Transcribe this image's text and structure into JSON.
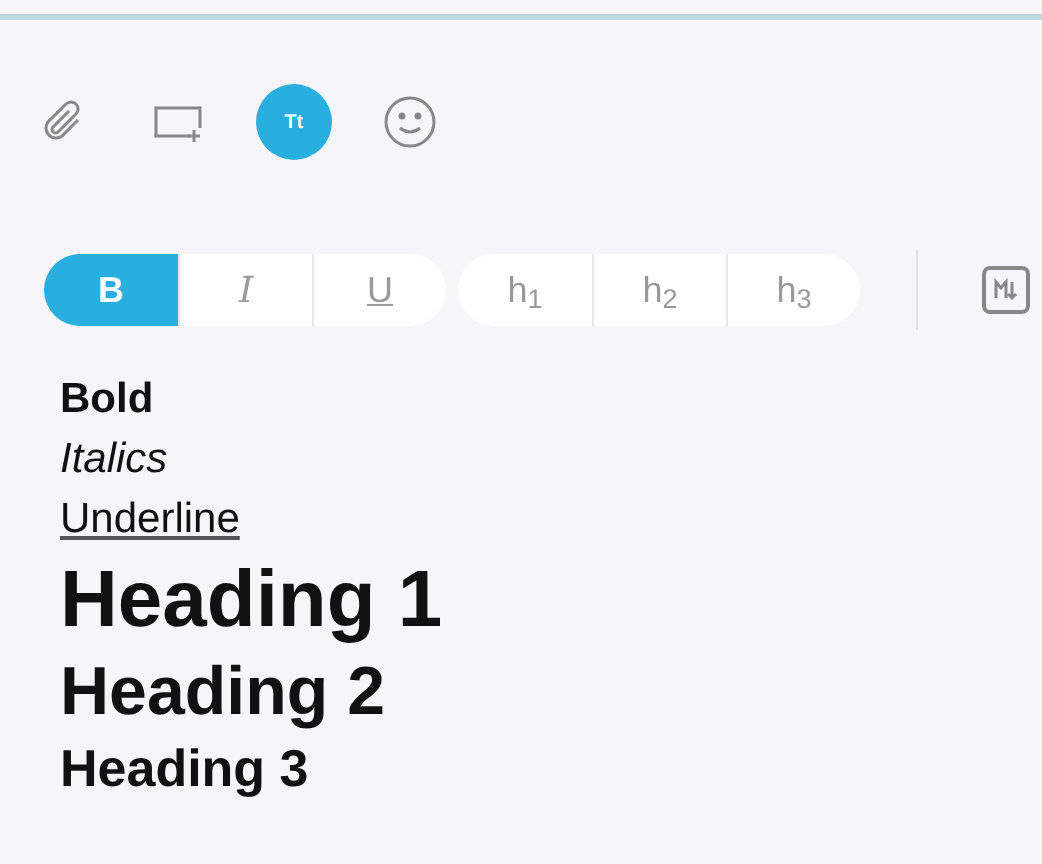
{
  "insert_toolbar": [
    {
      "kind": "attachment",
      "selected": false
    },
    {
      "kind": "image",
      "selected": false
    },
    {
      "kind": "text",
      "selected": true,
      "label": "Tt"
    },
    {
      "kind": "emoji",
      "selected": false
    }
  ],
  "format_groups": [
    {
      "buttons": [
        {
          "kind": "bold",
          "label": "B",
          "selected": true
        },
        {
          "kind": "italic",
          "label": "I",
          "selected": false
        },
        {
          "kind": "underline",
          "label": "U",
          "selected": false
        }
      ]
    },
    {
      "buttons": [
        {
          "kind": "heading",
          "label": "h$_{1}$",
          "selected": false
        },
        {
          "kind": "heading",
          "label": "h$_{2}$",
          "selected": false
        },
        {
          "kind": "heading",
          "label": "h$_{3}$",
          "selected": false
        }
      ]
    }
  ],
  "markdown_toggle": {
    "on": false
  },
  "preview": [
    {
      "kind": "bold",
      "text": "Bold"
    },
    {
      "kind": "italic",
      "text": "Italics"
    },
    {
      "kind": "underline",
      "text": "Underline"
    },
    {
      "kind": "h1",
      "text": "Heading 1"
    },
    {
      "kind": "h2",
      "text": "Heading 2"
    },
    {
      "kind": "h3",
      "text": "Heading 3"
    }
  ]
}
